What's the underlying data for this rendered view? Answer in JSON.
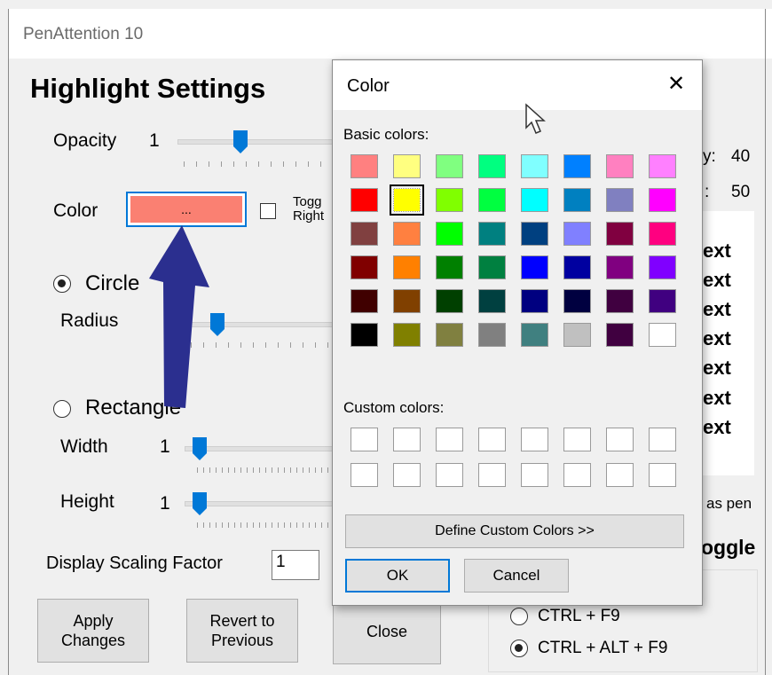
{
  "window": {
    "title": "PenAttention 10"
  },
  "highlight": {
    "heading": "Highlight Settings",
    "opacity_label": "Opacity",
    "opacity_value": "1",
    "color_label": "Color",
    "color_button_text": "...",
    "color_value": "#fa8072",
    "toggle_label_line1": "Togg",
    "toggle_label_line2": "Right",
    "circle_label": "Circle",
    "radius_label": "Radius",
    "rectangle_label": "Rectangle",
    "width_label": "Width",
    "width_value": "1",
    "height_label": "Height",
    "height_value": "1",
    "scaling_label": "Display Scaling Factor",
    "scaling_value": "1"
  },
  "right_panel": {
    "row1_tail": "y:",
    "row1_value": "40",
    "row2_tail": ":",
    "row2_value": "50",
    "sample_lines": [
      "ext",
      "ext",
      "ext",
      "ext",
      "ext",
      "ext",
      "ext"
    ],
    "as_pen": "as pen",
    "toggle_heading": "oggle",
    "hotkey1": "CTRL + F9",
    "hotkey2": "CTRL + ALT + F9"
  },
  "buttons": {
    "apply": "Apply\nChanges",
    "revert": "Revert to\nPrevious",
    "close": "Close"
  },
  "dialog": {
    "title": "Color",
    "close_glyph": "✕",
    "basic_label": "Basic colors:",
    "custom_label": "Custom colors:",
    "define_button": "Define Custom Colors >>",
    "ok_button": "OK",
    "cancel_button": "Cancel",
    "selected_color": "#ffff00",
    "basic_colors": [
      [
        "#ff8080",
        "#ffff80",
        "#80ff80",
        "#00ff80",
        "#80ffff",
        "#0080ff",
        "#ff80c0",
        "#ff80ff"
      ],
      [
        "#ff0000",
        "#ffff00",
        "#80ff00",
        "#00ff40",
        "#00ffff",
        "#0080c0",
        "#8080c0",
        "#ff00ff"
      ],
      [
        "#804040",
        "#ff8040",
        "#00ff00",
        "#008080",
        "#004080",
        "#8080ff",
        "#800040",
        "#ff0080"
      ],
      [
        "#800000",
        "#ff8000",
        "#008000",
        "#008040",
        "#0000ff",
        "#0000a0",
        "#800080",
        "#8000ff"
      ],
      [
        "#400000",
        "#804000",
        "#004000",
        "#004040",
        "#000080",
        "#000040",
        "#400040",
        "#400080"
      ],
      [
        "#000000",
        "#808000",
        "#808040",
        "#808080",
        "#408080",
        "#c0c0c0",
        "#400040",
        "#ffffff"
      ]
    ]
  },
  "annotation": {
    "arrow_color": "#2b2f8f"
  }
}
